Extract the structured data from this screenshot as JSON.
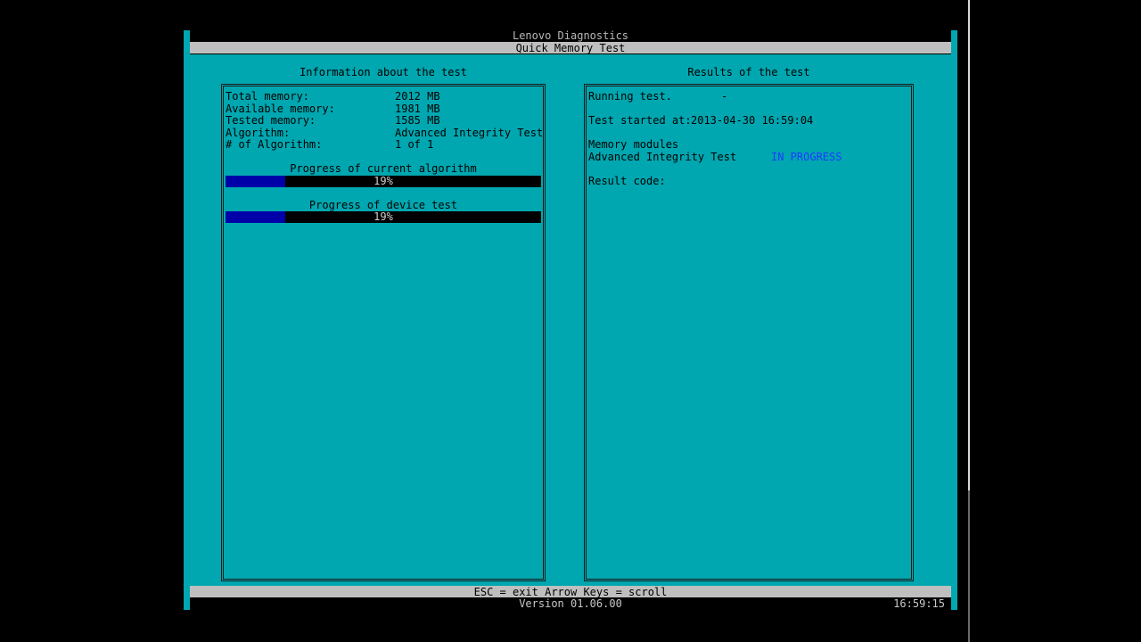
{
  "header": {
    "app_title": "Lenovo Diagnostics",
    "test_title": "Quick Memory Test"
  },
  "info_panel": {
    "heading": "Information about the test",
    "rows": [
      {
        "label": "Total memory:",
        "value": "2012 MB"
      },
      {
        "label": "Available memory:",
        "value": "1981 MB"
      },
      {
        "label": "Tested memory:",
        "value": "1585 MB"
      },
      {
        "label": "Algorithm:",
        "value": "Advanced Integrity Test"
      },
      {
        "label": "# of Algorithm:",
        "value": "1 of 1"
      }
    ],
    "progress_current": {
      "title": "Progress of current algorithm",
      "percent": 19,
      "text": "19%"
    },
    "progress_device": {
      "title": "Progress of device test",
      "percent": 19,
      "text": "19%"
    }
  },
  "results_panel": {
    "heading": "Results of the test",
    "running_label": "Running test.",
    "running_spinner": "-",
    "started_label": "Test started at:",
    "started_value": "2013-04-30 16:59:04",
    "modules_label": "Memory modules",
    "module_name": "Advanced Integrity Test",
    "module_status": "IN PROGRESS",
    "result_code_label": "Result code:"
  },
  "footer": {
    "keys": "ESC = exit  Arrow Keys = scroll",
    "version": "Version 01.06.00",
    "clock": "16:59:15"
  },
  "colors": {
    "background": "#00a7b0",
    "progress_fill": "#0000a8",
    "status_in_progress": "#1c3cff"
  }
}
